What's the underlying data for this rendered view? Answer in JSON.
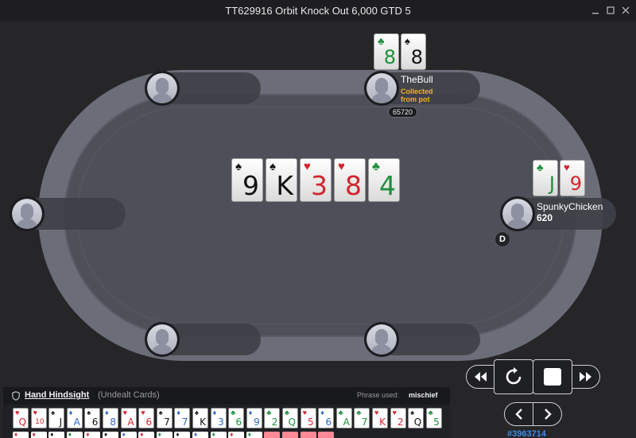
{
  "window": {
    "title": "TT629916 Orbit Knock Out 6,000 GTD 5",
    "minimize_icon": "minimize-icon",
    "maximize_icon": "maximize-icon",
    "close_icon": "close-icon"
  },
  "board": {
    "cards": [
      {
        "rank": "9",
        "suit": "♠",
        "color": "#111111"
      },
      {
        "rank": "K",
        "suit": "♠",
        "color": "#111111"
      },
      {
        "rank": "3",
        "suit": "♥",
        "color": "#d3262d"
      },
      {
        "rank": "8",
        "suit": "♥",
        "color": "#d3262d"
      },
      {
        "rank": "4",
        "suit": "♣",
        "color": "#1d8f3c"
      }
    ]
  },
  "players": {
    "thebull": {
      "name": "TheBull",
      "status": "Collected from pot",
      "status_color": "#f2b01e",
      "bet": "65720",
      "cards": [
        {
          "rank": "8",
          "suit": "♣",
          "color": "#1d8f3c"
        },
        {
          "rank": "8",
          "suit": "♠",
          "color": "#111111"
        }
      ]
    },
    "spunky": {
      "name": "SpunkyChicken",
      "stack": "620",
      "cards": [
        {
          "rank": "J",
          "suit": "♣",
          "color": "#1d8f3c"
        },
        {
          "rank": "9",
          "suit": "♥",
          "color": "#d3262d"
        }
      ]
    }
  },
  "dealer_button": "D",
  "controls": {
    "rewind_icon": "rewind-icon",
    "replay_icon": "replay-icon",
    "stop_icon": "stop-icon",
    "fast_forward_icon": "fast-forward-icon",
    "prev_icon": "chevron-left-icon",
    "next_icon": "chevron-right-icon",
    "hand_id": "#3963714"
  },
  "hindsight": {
    "shield_icon": "shield-icon",
    "title": "Hand Hindsight",
    "subtitle": "(Undealt Cards)",
    "phrase_label": "Phrase used:",
    "phrase_value": "mischief",
    "cards": [
      {
        "rank": "Q",
        "suit": "♥",
        "color": "#d3262d"
      },
      {
        "rank": "10",
        "suit": "♥",
        "color": "#d3262d"
      },
      {
        "rank": "J",
        "suit": "♠",
        "color": "#111111"
      },
      {
        "rank": "A",
        "suit": "♦",
        "color": "#2d67c7"
      },
      {
        "rank": "6",
        "suit": "♠",
        "color": "#111111"
      },
      {
        "rank": "8",
        "suit": "♦",
        "color": "#2d67c7"
      },
      {
        "rank": "A",
        "suit": "♥",
        "color": "#d3262d"
      },
      {
        "rank": "6",
        "suit": "♥",
        "color": "#d3262d"
      },
      {
        "rank": "7",
        "suit": "♠",
        "color": "#111111"
      },
      {
        "rank": "7",
        "suit": "♦",
        "color": "#2d67c7"
      },
      {
        "rank": "K",
        "suit": "♠",
        "color": "#111111"
      },
      {
        "rank": "3",
        "suit": "♦",
        "color": "#2d67c7"
      },
      {
        "rank": "6",
        "suit": "♣",
        "color": "#1d8f3c"
      },
      {
        "rank": "9",
        "suit": "♦",
        "color": "#2d67c7"
      },
      {
        "rank": "2",
        "suit": "♣",
        "color": "#1d8f3c"
      },
      {
        "rank": "Q",
        "suit": "♣",
        "color": "#1d8f3c"
      },
      {
        "rank": "5",
        "suit": "♥",
        "color": "#d3262d"
      },
      {
        "rank": "6",
        "suit": "♦",
        "color": "#2d67c7"
      },
      {
        "rank": "A",
        "suit": "♣",
        "color": "#1d8f3c"
      },
      {
        "rank": "7",
        "suit": "♣",
        "color": "#1d8f3c"
      },
      {
        "rank": "K",
        "suit": "♥",
        "color": "#d3262d"
      },
      {
        "rank": "2",
        "suit": "♥",
        "color": "#d3262d"
      },
      {
        "rank": "Q",
        "suit": "♠",
        "color": "#111111"
      },
      {
        "rank": "5",
        "suit": "♣",
        "color": "#1d8f3c"
      }
    ],
    "row2_colors": [
      "#d3262d",
      "#d3262d",
      "#111111",
      "#1d8f3c",
      "#d3262d",
      "#111111",
      "#2d67c7",
      "#d3262d",
      "#1d8f3c",
      "#111111",
      "#2d67c7",
      "#1d8f3c",
      "#d3262d",
      "#1d8f3c",
      "#ff8a95",
      "#ff8a95",
      "#ff8a95",
      "#ff8a95"
    ]
  }
}
